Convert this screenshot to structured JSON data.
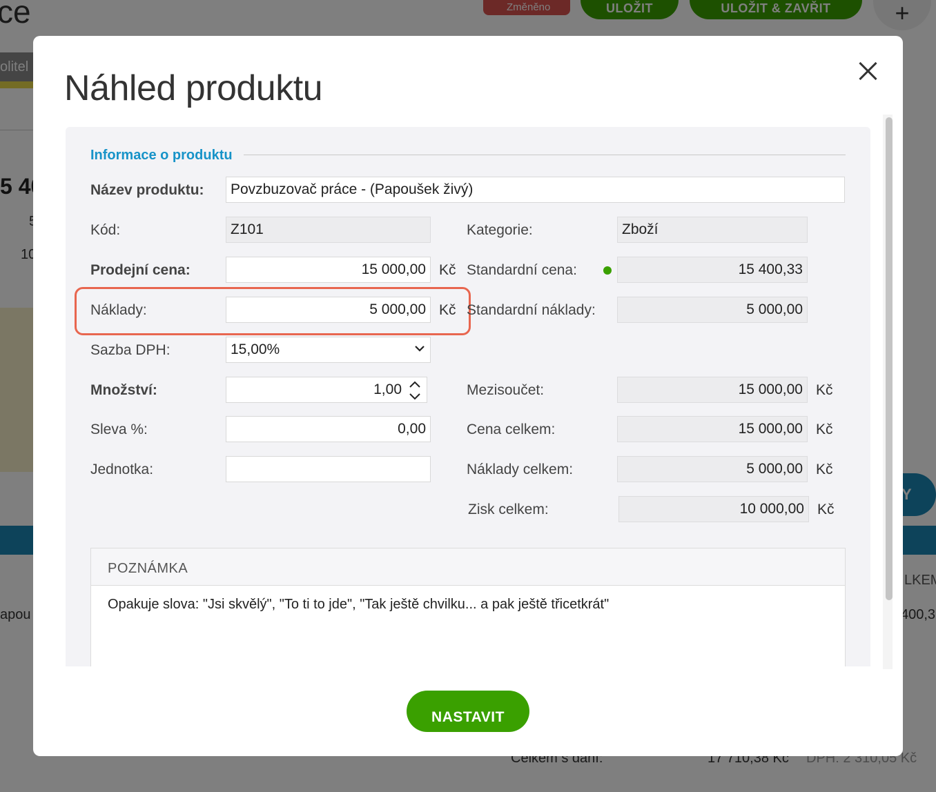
{
  "background": {
    "title_fragment": "ce",
    "changed_badge": "Změněno",
    "save_label": "ULOŽIT",
    "save_close_label": "ULOŽIT & ZAVŘIT",
    "plus_label": "+",
    "tab_fragment": "olitel",
    "left_num": "5 40",
    "left_five": "5",
    "left_ten": "10",
    "left_row": "apou",
    "right_pill": "Y",
    "right_kem": "LKEM",
    "right_val": "400,3",
    "total_label": "Celkem s daní:",
    "total_value": "17 710,38 Kč",
    "total_dph": "DPH: 2 310,05 Kč"
  },
  "modal": {
    "title": "Náhled produktu",
    "section_title": "Informace o produktu",
    "fields": {
      "name_label": "Název produktu:",
      "name_value": "Povzbuzovač práce - (Papoušek živý)",
      "code_label": "Kód:",
      "code_value": "Z101",
      "category_label": "Kategorie:",
      "category_value": "Zboží",
      "sale_price_label": "Prodejní cena:",
      "sale_price_value": "15 000,00",
      "standard_price_label": "Standardní cena:",
      "standard_price_value": "15 400,33",
      "costs_label": "Náklady:",
      "costs_value": "5 000,00",
      "standard_costs_label": "Standardní náklady:",
      "standard_costs_value": "5 000,00",
      "vat_label": "Sazba DPH:",
      "vat_value": "15,00%",
      "qty_label": "Množství:",
      "qty_value": "1,00",
      "subtotal_label": "Mezisoučet:",
      "subtotal_value": "15 000,00",
      "discount_label": "Sleva %:",
      "discount_value": "0,00",
      "total_price_label": "Cena celkem:",
      "total_price_value": "15 000,00",
      "unit_label": "Jednotka:",
      "unit_value": "",
      "total_costs_label": "Náklady celkem:",
      "total_costs_value": "5 000,00",
      "total_profit_label": "Zisk celkem:",
      "total_profit_value": "10 000,00",
      "currency": "Kč"
    },
    "note": {
      "heading": "POZNÁMKA",
      "text": "Opakuje slova: \"Jsi skvělý\", \"To ti to jde\", \"Tak ještě chvilku... a pak ještě třicetkrát\""
    },
    "submit_label": "NASTAVIT"
  },
  "colors": {
    "accent_blue": "#1793c8",
    "primary_green": "#3aa000",
    "highlight_red": "#e8664f"
  }
}
